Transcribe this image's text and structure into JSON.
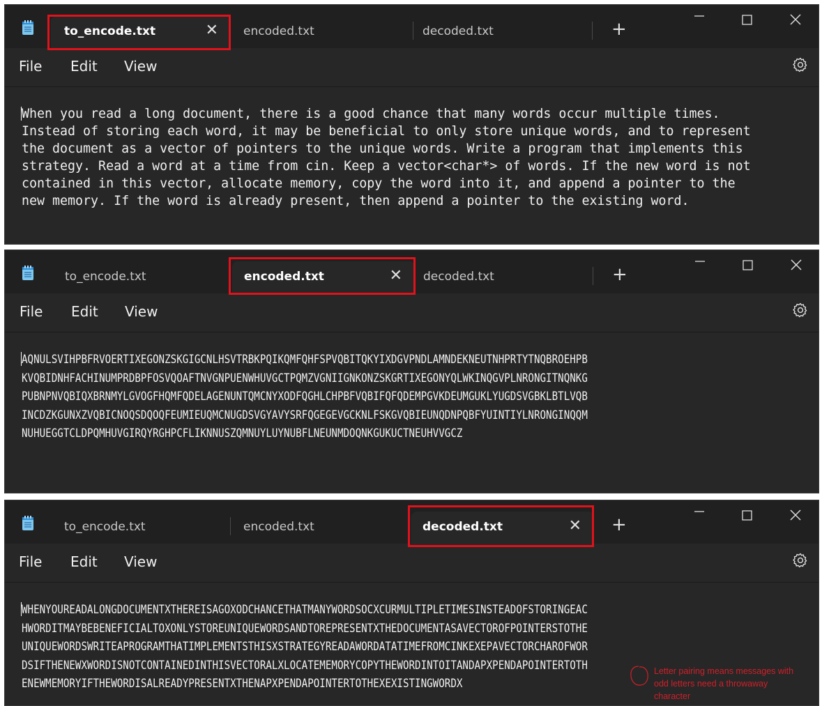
{
  "tabs": [
    "to_encode.txt",
    "encoded.txt",
    "decoded.txt"
  ],
  "menu": [
    "File",
    "Edit",
    "View"
  ],
  "windows": [
    {
      "active_tab": 0,
      "text": "When you read a long document, there is a good chance that many words occur multiple times.\nInstead of storing each word, it may be beneficial to only store unique words, and to represent\nthe document as a vector of pointers to the unique words. Write a program that implements this\nstrategy. Read a word at a time from cin. Keep a vector<char*> of words. If the new word is not\ncontained in this vector, allocate memory, copy the word into it, and append a pointer to the\nnew memory. If the word is already present, then append a pointer to the existing word."
    },
    {
      "active_tab": 1,
      "text": "AQNULSVIHPBFRVOERTIXEGONZSKGIGCNLHSVTRBKPQIKQMFQHFSPVQBITQKYIXDGVPNDLAMNDEKNEUTNHPRTYTNQBROEHPB\nKVQBIDNHFACHINUMPRDBPFOSVQOAFTNVGNPUENWHUVGCTPQMZVGNIIGNKONZSKGRTIXEGONYQLWKINQGVPLNRONGITNQNKG\nPUBNPNVQBIQXBRNMYLGVOGFHQMFQDELAGENUNTQMCNYXODFQGHLCHPBFVQBIFQFQDEMPGVKDEUMGUKLYUGDSVGBKLBTLVQB\nINCDZKGUNXZVQBICNOQSDQOQFEUMIEUQMCNUGDSVGYAVYSRFQGEGEVGCKNLFSKGVQBIEUNQDNPQBFYUINTIYLNRONGINQQM\nNUHUEGGTCLDPQMHUVGIRQYRGHPCFLIKNNUSZQMNUYLUYNUBFLNEUNMDOQNKGUKUCTNEUHVVGCZ"
    },
    {
      "active_tab": 2,
      "text": "WHENYOUREADALONGDOCUMENTXTHEREISAGOXODCHANCETHATMANYWORDSOCXCURMULTIPLETIMESINSTEADOFSTORINGEAC\nHWORDITMAYBEBENEFICIALTOXONLYSTOREUNIQUEWORDSANDTOREPRESENTXTHEDOCUMENTASAVECTOROFPOINTERSTOTHE\nUNIQUEWORDSWRITEAPROGRAMTHATIMPLEMENTSTHISXSTRATEGYREADAWORDATATIMEFROMCINKEXEPAVECTORCHAROFWOR\nDSIFTHENEWXWORDISNOTCONTAINEDINTHISVECTORALXLOCATEMEMORYCOPYTHEWORDINTOITANDAPXPENDAPOINTERTOTH\nENEWMEMORYIFTHEWORDISALREADYPRESENTXTHENAPXPENDAPOINTERTOTHEXEXISTINGWORDX",
      "annotation": "Letter pairing means messages with\nodd letters need a throwaway\ncharacter"
    }
  ],
  "icons": [
    "notepad-icon",
    "close-icon",
    "plus-icon",
    "minimize-icon",
    "maximize-icon",
    "gear-icon"
  ],
  "colors": {
    "highlight": "#e0121b",
    "annotation": "#d0202a",
    "background": "#272727",
    "titlebar": "#202020"
  }
}
